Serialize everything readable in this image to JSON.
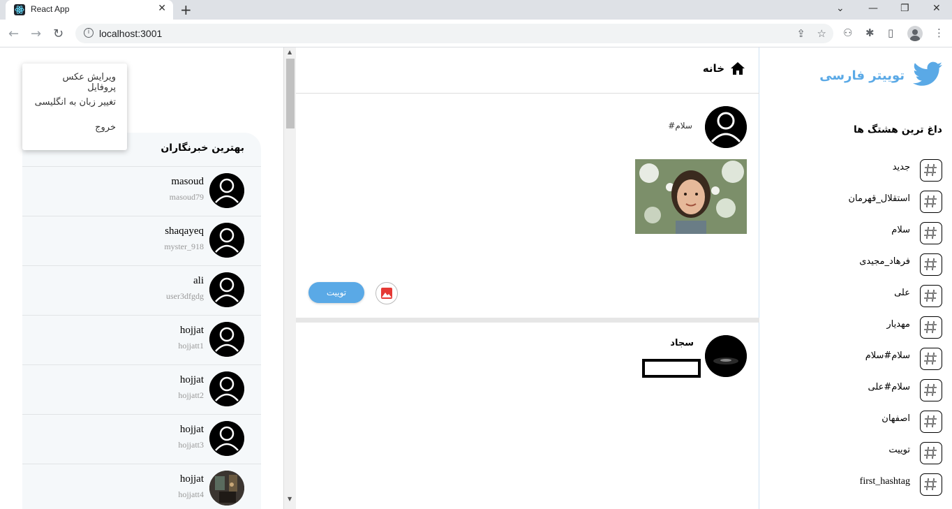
{
  "browser": {
    "tab_title": "React App",
    "url": "localhost:3001"
  },
  "menu": {
    "items": [
      "ویرایش عکس پروفایل",
      "تغییر زبان به انگلیسی",
      "خروج"
    ]
  },
  "reporters": {
    "title": "بهترین خبرنگاران",
    "items": [
      {
        "name": "masoud",
        "handle": "masoud79"
      },
      {
        "name": "shaqayeq",
        "handle": "myster_918"
      },
      {
        "name": "ali",
        "handle": "user3dfgdg"
      },
      {
        "name": "hojjat",
        "handle": "hojjatt1"
      },
      {
        "name": "hojjat",
        "handle": "hojjatt2"
      },
      {
        "name": "hojjat",
        "handle": "hojjatt3"
      },
      {
        "name": "hojjat",
        "handle": "hojjatt4"
      }
    ]
  },
  "home": {
    "title": "خانه"
  },
  "compose": {
    "text": "#سلام",
    "tweet_button": "توییت"
  },
  "tweet": {
    "author": "سجاد"
  },
  "sidebar": {
    "brand": "توییتر فارسی",
    "trending_title": "داغ ترین هشتگ ها",
    "hashtags": [
      "جدید",
      "استقلال_قهرمان",
      "سلام",
      "فرهاد_مجیدی",
      "علی",
      "مهدیار",
      "سلام#سلام",
      "سلام#علی",
      "اصفهان",
      "توییت",
      "first_hashtag"
    ]
  },
  "colors": {
    "accent": "#5aa9e6",
    "reporters_bg": "#f5f8fa",
    "image_button_icon": "#e53935"
  }
}
